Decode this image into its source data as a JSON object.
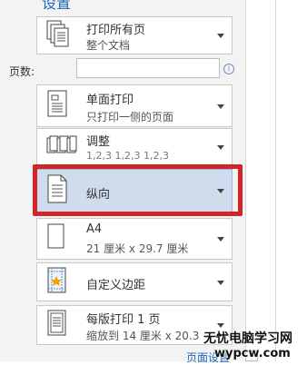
{
  "header": {
    "title": "设置"
  },
  "print_scope": {
    "title": "打印所有页",
    "subtitle": "整个文档"
  },
  "pages": {
    "label": "页数:",
    "value": "",
    "info_icon": "i"
  },
  "sides": {
    "title": "单面打印",
    "subtitle": "只打印一侧的页面"
  },
  "collate": {
    "title": "调整",
    "subtitle": "1,2,3    1,2,3    1,2,3"
  },
  "orientation": {
    "title": "纵向"
  },
  "paper": {
    "title": "A4",
    "subtitle": "21 厘米 x 29.7 厘米"
  },
  "margins": {
    "title": "自定义边距"
  },
  "scaling": {
    "title": "每版打印 1 页",
    "subtitle": "缩放到 14 厘米 x 20.3"
  },
  "footer": {
    "page_setup_link": "页面设置"
  },
  "watermark": {
    "line1": "无忧电脑学习网",
    "line2": "wypcw.com"
  },
  "colors": {
    "highlight": "#d1252a",
    "selected_bg": "#cfdcee",
    "accent": "#1e68b8"
  }
}
